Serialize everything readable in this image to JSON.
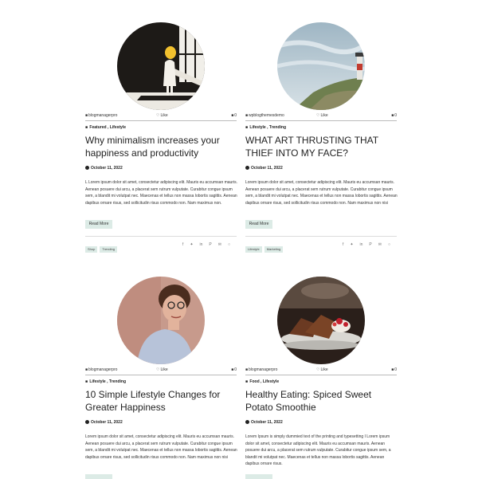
{
  "posts": [
    {
      "author": "blogmanagerpro",
      "likes_label": "Like",
      "comments": "0",
      "categories": [
        "Featured",
        "Lifestyle"
      ],
      "title": "Why minimalism increases your happiness and productivity",
      "date": "October 11, 2022",
      "excerpt": "L Lorem ipsum dolor sit amet, consectetur adipiscing elit. Mauris eu accumsan mauris. Aenean posuere dui arcu, a placerat sem rutrum vulputate. Curabitur congue ipsum sem, a blandit mi volutpat nec. Maecenas et tellus non massa lobortis sagittis. Aenean dapibus ornare risus, sed sollicitudin risus commodo non. Nam maximus non.",
      "read_more": "Read More",
      "tags": [
        "Shop",
        "Trending"
      ],
      "image": "woman-in-window-illustration"
    },
    {
      "author": "wpblogthemesdemo",
      "likes_label": "Like",
      "comments": "0",
      "categories": [
        "Lifestyle",
        "Trending"
      ],
      "title": "WHAT ART THRUSTING THAT THIEF INTO MY FACE?",
      "date": "October 11, 2022",
      "excerpt": "Lorem ipsum dolor sit amet, consectetur adipiscing elit. Mauris eu accumsan mauris. Aenean posuere dui arcu, a placerat sem rutrum vulputate. Curabitur congue ipsum sem, a blandit mi volutpat nec. Maecenas et tellus non massa lobortis sagittis. Aenean dapibus ornare risus, sed sollicitudin risus commodo non. Nam maximus non nisi",
      "read_more": "Read More",
      "tags": [
        "Lifestyle",
        "Marketing"
      ],
      "image": "lighthouse-cliff-photo"
    },
    {
      "author": "blogmanagerpro",
      "likes_label": "Like",
      "comments": "0",
      "categories": [
        "Lifestyle",
        "Trending"
      ],
      "title": "10 Simple Lifestyle Changes for Greater Happiness",
      "date": "October 11, 2022",
      "excerpt": "Lorem ipsum dolor sit amet, consectetur adipiscing elit. Mauris eu accumsan mauris. Aenean posuere dui arcu, a placerat sem rutrum vulputate. Curabitur congue ipsum sem, a blandit mi volutpat nec. Maecenas et tellus non massa lobortis sagittis. Aenean dapibus ornare risus, sed sollicitudin risus commodo non. Nam maximus non nisi",
      "image": "woman-with-glasses-photo"
    },
    {
      "author": "blogmanagerpro",
      "likes_label": "Like",
      "comments": "0",
      "categories": [
        "Food",
        "Lifestyle"
      ],
      "title": "Healthy Eating: Spiced Sweet Potato Smoothie",
      "date": "October 11, 2022",
      "excerpt": "Lorem Ipsum is simply dummied text of the printing and typesetting I Lorem ipsum dolor sit amet, consectetur adipiscing elit. Mauris eu accumsan mauris. Aenean posuere dui arcu, a placerat sem rutrum vulputate. Curabitur congue ipsum sem, a blandit mi volutpat nec. Maecenas et tellus non massa lobortis sagittis. Aenean dapibus ornare risus.",
      "image": "dessert-plate-photo"
    }
  ],
  "share_icons": [
    "facebook-icon",
    "twitter-icon",
    "linkedin-icon",
    "pinterest-icon",
    "email-icon",
    "whatsapp-icon"
  ],
  "colors": {
    "accent_chip": "#dcebe6",
    "text": "#222222"
  }
}
